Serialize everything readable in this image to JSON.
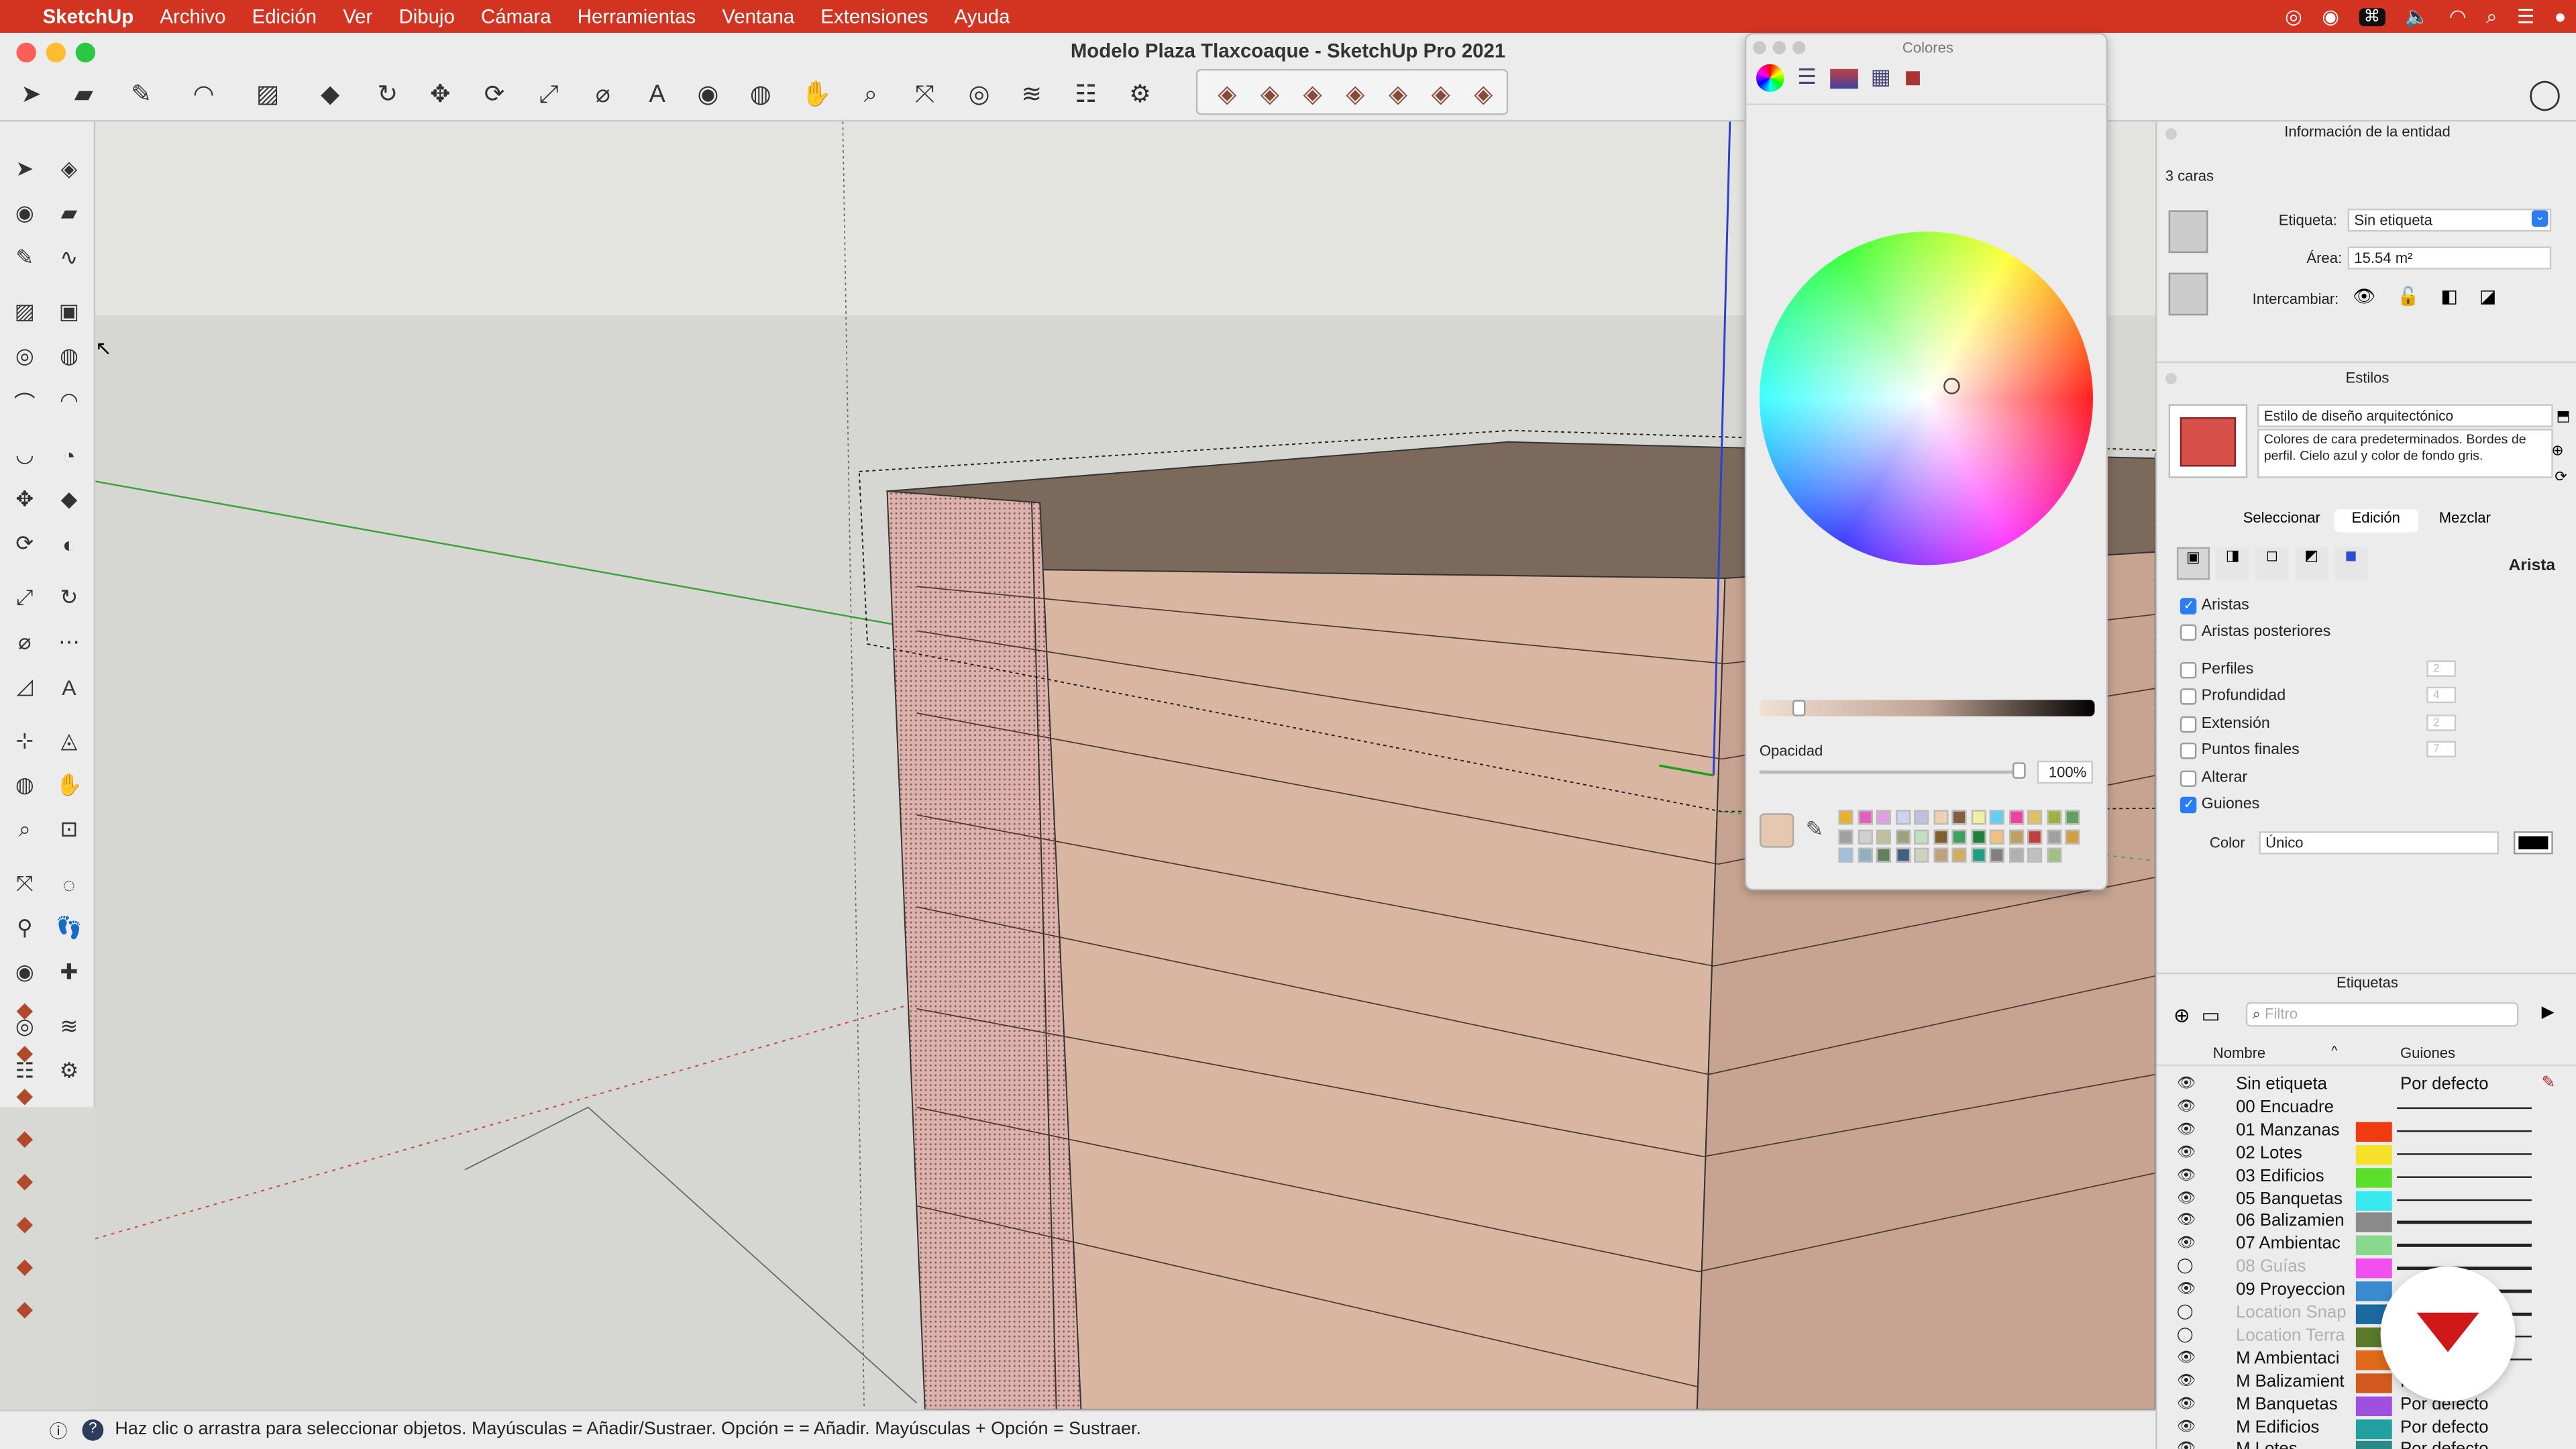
{
  "menubar": {
    "app": "SketchUp",
    "items": [
      "Archivo",
      "Edición",
      "Ver",
      "Dibujo",
      "Cámara",
      "Herramientas",
      "Ventana",
      "Extensiones",
      "Ayuda"
    ]
  },
  "window": {
    "title": "Modelo Plaza Tlaxcoaque  - SketchUp Pro 2021"
  },
  "toolbar": {
    "icons": [
      "select-icon",
      "eraser-icon",
      "pencil-icon",
      "arc-icon",
      "rectangle-icon",
      "push-pull-icon",
      "offset-icon",
      "move-icon",
      "rotate-icon",
      "scale-icon",
      "tape-measure-icon",
      "text-icon",
      "paint-bucket-icon",
      "orbit-icon",
      "pan-icon",
      "zoom-icon",
      "zoom-extents-icon",
      "warehouse-icon",
      "extension-warehouse-icon",
      "layout-icon",
      "extension-manager-icon"
    ],
    "sandbox_icons": [
      "from-contours-icon",
      "from-scratch-icon",
      "smoove-icon",
      "stamp-icon",
      "drape-icon",
      "add-detail-icon",
      "flip-edge-icon"
    ]
  },
  "colors_panel": {
    "title": "Colores",
    "opacity_label": "Opacidad",
    "opacity_value": "100%",
    "current_color": "#e6c8b0",
    "palette": [
      "#e8b030",
      "#e060c0",
      "#e0a0e0",
      "#d0d0f0",
      "#c0c0e0",
      "#f0d0b0",
      "#806040",
      "#f0f0a0",
      "#60d0f0",
      "#f040a0",
      "#e0c060",
      "#a0b040",
      "#60a060",
      "#a0a0a0",
      "#d0d0d0",
      "#c0c0a0",
      "#a0a080",
      "#c0e0c0",
      "#806030",
      "#40a060",
      "#208040",
      "#f0c080",
      "#c0a060",
      "#c04040",
      "#a0a0a0",
      "#d0a040",
      "#a0c0e0",
      "#90b0c0",
      "#608060",
      "#406080",
      "#d0d0c0",
      "#c0a080",
      "#d0b060",
      "#20a080",
      "#808080",
      "#b0b0b0",
      "#c0c0c0",
      "#a0c080"
    ]
  },
  "entity_info": {
    "title": "Información de la entidad",
    "selection": "3 caras",
    "tag_label": "Etiqueta:",
    "tag_value": "Sin etiqueta",
    "area_label": "Área:",
    "area_value": "15.54 m²",
    "toggle_label": "Intercambiar:"
  },
  "styles": {
    "title": "Estilos",
    "style_name": "Estilo de diseño arquitectónico",
    "style_desc": "Colores de cara predeterminados. Bordes de perfil. Cielo azul y color de fondo gris.",
    "tabs": [
      "Seleccionar",
      "Edición",
      "Mezclar"
    ],
    "active_tab": "Edición",
    "section_label": "Arista",
    "options": [
      {
        "label": "Aristas",
        "checked": true,
        "value": ""
      },
      {
        "label": "Aristas posteriores",
        "checked": false,
        "value": ""
      },
      {
        "label": "Perfiles",
        "checked": false,
        "value": "2"
      },
      {
        "label": "Profundidad",
        "checked": false,
        "value": "4"
      },
      {
        "label": "Extensión",
        "checked": false,
        "value": "2"
      },
      {
        "label": "Puntos finales",
        "checked": false,
        "value": "7"
      },
      {
        "label": "Alterar",
        "checked": false,
        "value": ""
      },
      {
        "label": "Guiones",
        "checked": true,
        "value": ""
      }
    ],
    "color_label": "Color",
    "color_value": "Único"
  },
  "tags": {
    "title": "Etiquetas",
    "filter_placeholder": "Filtro",
    "col_name": "Nombre",
    "col_dashes": "Guiones",
    "rows": [
      {
        "name": "Sin etiqueta",
        "visible": true,
        "color": "",
        "dash": "Por defecto"
      },
      {
        "name": "00 Encuadre",
        "visible": true,
        "color": "",
        "dash": ""
      },
      {
        "name": "01 Manzanas",
        "visible": true,
        "color": "#f03a10",
        "dash": ""
      },
      {
        "name": "02 Lotes",
        "visible": true,
        "color": "#f5e02a",
        "dash": ""
      },
      {
        "name": "03 Edificios",
        "visible": true,
        "color": "#5ae02a",
        "dash": ""
      },
      {
        "name": "05 Banquetas",
        "visible": true,
        "color": "#3ae8f0",
        "dash": ""
      },
      {
        "name": "06 Balizamien",
        "visible": true,
        "color": "#8a8a8a",
        "dash": ""
      },
      {
        "name": "07 Ambientac",
        "visible": true,
        "color": "#88d890",
        "dash": ""
      },
      {
        "name": "08 Guías",
        "visible": false,
        "color": "#f050f0",
        "dash": ""
      },
      {
        "name": "09 Proyeccion",
        "visible": true,
        "color": "#3a8ad0",
        "dash": ""
      },
      {
        "name": "Location Snap",
        "visible": false,
        "color": "#1a6aa0",
        "dash": ""
      },
      {
        "name": "Location Terra",
        "visible": false,
        "color": "#5a7a2a",
        "dash": ""
      },
      {
        "name": "M Ambientaci",
        "visible": true,
        "color": "#e06a1a",
        "dash": ""
      },
      {
        "name": "M Balizamient",
        "visible": true,
        "color": "#d05a20",
        "dash": "Por defecto"
      },
      {
        "name": "M Banquetas",
        "visible": true,
        "color": "#a050e0",
        "dash": "Por defecto"
      },
      {
        "name": "M Edificios",
        "visible": true,
        "color": "#20a0a0",
        "dash": "Por defecto"
      },
      {
        "name": "M Lotes",
        "visible": true,
        "color": "#2a8a8a",
        "dash": "Por defecto"
      }
    ]
  },
  "status": {
    "text": "Haz clic o arrastra para seleccionar objetos. Mayúsculas = Añadir/Sustraer. Opción = = Añadir. Mayúsculas + Opción = Sustraer."
  }
}
